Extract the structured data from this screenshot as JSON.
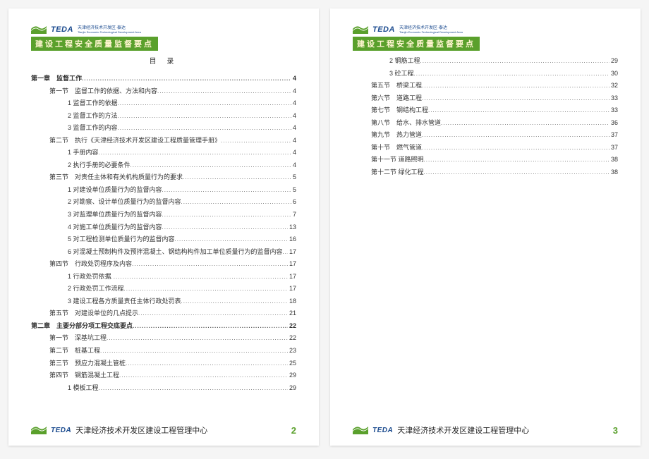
{
  "logo_text": "TEDA",
  "logo_sub_top": "天津经济技术开发区·泰达",
  "logo_sub_bottom": "Tianjin Economic-Technological Development Area",
  "title_bar": "建设工程安全质量监督要点",
  "mulu": "目 录",
  "footer_text": "天津经济技术开发区建设工程管理中心",
  "page_left_num": "2",
  "page_right_num": "3",
  "toc_left": [
    {
      "label": "第一章　监督工作",
      "page": "4",
      "indent": 0
    },
    {
      "label": "第一节　监督工作的依据、方法和内容",
      "page": "4",
      "indent": 1
    },
    {
      "label": "1 监督工作的依据",
      "page": "4",
      "indent": 2
    },
    {
      "label": "2 监督工作的方法",
      "page": "4",
      "indent": 2
    },
    {
      "label": "3 监督工作的内容",
      "page": "4",
      "indent": 2
    },
    {
      "label": "第二节　执行《天津经济技术开发区建设工程质量管理手册》",
      "page": "4",
      "indent": 1
    },
    {
      "label": "1 手册内容",
      "page": "4",
      "indent": 2
    },
    {
      "label": "2 执行手册的必要条件",
      "page": "4",
      "indent": 2
    },
    {
      "label": "第三节　对责任主体和有关机构质量行为的要求",
      "page": "5",
      "indent": 1
    },
    {
      "label": "1 对建设单位质量行为的监督内容",
      "page": "5",
      "indent": 2
    },
    {
      "label": "2 对勘察、设计单位质量行为的监督内容",
      "page": "6",
      "indent": 2
    },
    {
      "label": "3 对监理单位质量行为的监督内容",
      "page": "7",
      "indent": 2
    },
    {
      "label": "4 对施工单位质量行为的监督内容",
      "page": "13",
      "indent": 2
    },
    {
      "label": "5 对工程检测单位质量行为的监督内容",
      "page": "16",
      "indent": 2
    },
    {
      "label": "6 对混凝土预制构件及预拌混凝土、钢结构构件加工单位质量行为的监督内容",
      "page": "17",
      "indent": 2
    },
    {
      "label": "第四节　行政处罚程序及内容",
      "page": "17",
      "indent": 1
    },
    {
      "label": "1 行政处罚依据",
      "page": "17",
      "indent": 2
    },
    {
      "label": "2 行政处罚工作流程",
      "page": "17",
      "indent": 2
    },
    {
      "label": "3 建设工程各方质量责任主体行政处罚表",
      "page": "18",
      "indent": 2
    },
    {
      "label": "第五节　对建设单位的几点提示",
      "page": "21",
      "indent": 1
    },
    {
      "label": "第二章　主要分部分项工程交底要点",
      "page": "22",
      "indent": 0
    },
    {
      "label": "第一节　深基坑工程",
      "page": "22",
      "indent": 1
    },
    {
      "label": "第二节　桩基工程",
      "page": "23",
      "indent": 1
    },
    {
      "label": "第三节　预应力混凝土管桩",
      "page": "25",
      "indent": 1
    },
    {
      "label": "第四节　钢筋混凝土工程",
      "page": "29",
      "indent": 1
    },
    {
      "label": "1 模板工程",
      "page": "29",
      "indent": 2
    }
  ],
  "toc_right": [
    {
      "label": "2 钢筋工程",
      "page": "29",
      "indent": 2
    },
    {
      "label": "3 砼工程",
      "page": "30",
      "indent": 2
    },
    {
      "label": "第五节　桥梁工程",
      "page": "32",
      "indent": 1
    },
    {
      "label": "第六节　道路工程",
      "page": "33",
      "indent": 1
    },
    {
      "label": "第七节　钢结构工程",
      "page": "33",
      "indent": 1
    },
    {
      "label": "第八节　给水、排水管道",
      "page": "36",
      "indent": 1
    },
    {
      "label": "第九节　热力管道",
      "page": "37",
      "indent": 1
    },
    {
      "label": "第十节　燃气管道",
      "page": "37",
      "indent": 1
    },
    {
      "label": "第十一节 道路照明",
      "page": "38",
      "indent": 1
    },
    {
      "label": "第十二节 绿化工程",
      "page": "38",
      "indent": 1
    }
  ]
}
